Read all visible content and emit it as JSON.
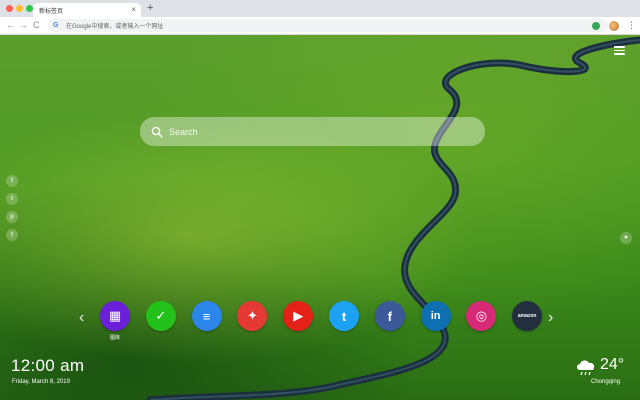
{
  "browser": {
    "tab_title": "新标签页",
    "tab_close": "×",
    "new_tab": "+",
    "omnibox_placeholder": "在Google中搜索，或者输入一个网址",
    "nav": {
      "back": "←",
      "forward": "→",
      "reload": "C"
    },
    "menu": "⋮"
  },
  "search": {
    "placeholder": "Search"
  },
  "side_social": [
    {
      "name": "facebook",
      "glyph": "f"
    },
    {
      "name": "twitter",
      "glyph": "t"
    },
    {
      "name": "pinterest",
      "glyph": "p"
    },
    {
      "name": "share",
      "glyph": "⇪"
    }
  ],
  "apps": [
    {
      "name": "photos",
      "label": "图库",
      "color": "#6a1fd8",
      "glyph": "▦"
    },
    {
      "name": "tasks",
      "label": "",
      "color": "#22c21a",
      "glyph": "✓"
    },
    {
      "name": "notes",
      "label": "",
      "color": "#2a86e8",
      "glyph": "≡"
    },
    {
      "name": "games",
      "label": "",
      "color": "#e53935",
      "glyph": "✦"
    },
    {
      "name": "youtube",
      "label": "",
      "color": "#e62117",
      "glyph": "▶"
    },
    {
      "name": "twitter",
      "label": "",
      "color": "#1da1f2",
      "glyph": "t"
    },
    {
      "name": "facebook",
      "label": "",
      "color": "#3b5998",
      "glyph": "f"
    },
    {
      "name": "linkedin",
      "label": "",
      "color": "#0e6fb1",
      "glyph": "in"
    },
    {
      "name": "instagram",
      "label": "",
      "color": "#d62976",
      "glyph": "◎"
    },
    {
      "name": "amazon",
      "label": "",
      "color": "#232f3e",
      "glyph": "amazon"
    }
  ],
  "clock": {
    "time": "12:00 am",
    "date": "Friday, March 8, 2019"
  },
  "weather": {
    "temp": "24°",
    "city": "Chongqing",
    "icon": "cloud-rain-icon"
  },
  "colors": {
    "grass": "#4f9a24",
    "river": "#1b2f3c"
  }
}
